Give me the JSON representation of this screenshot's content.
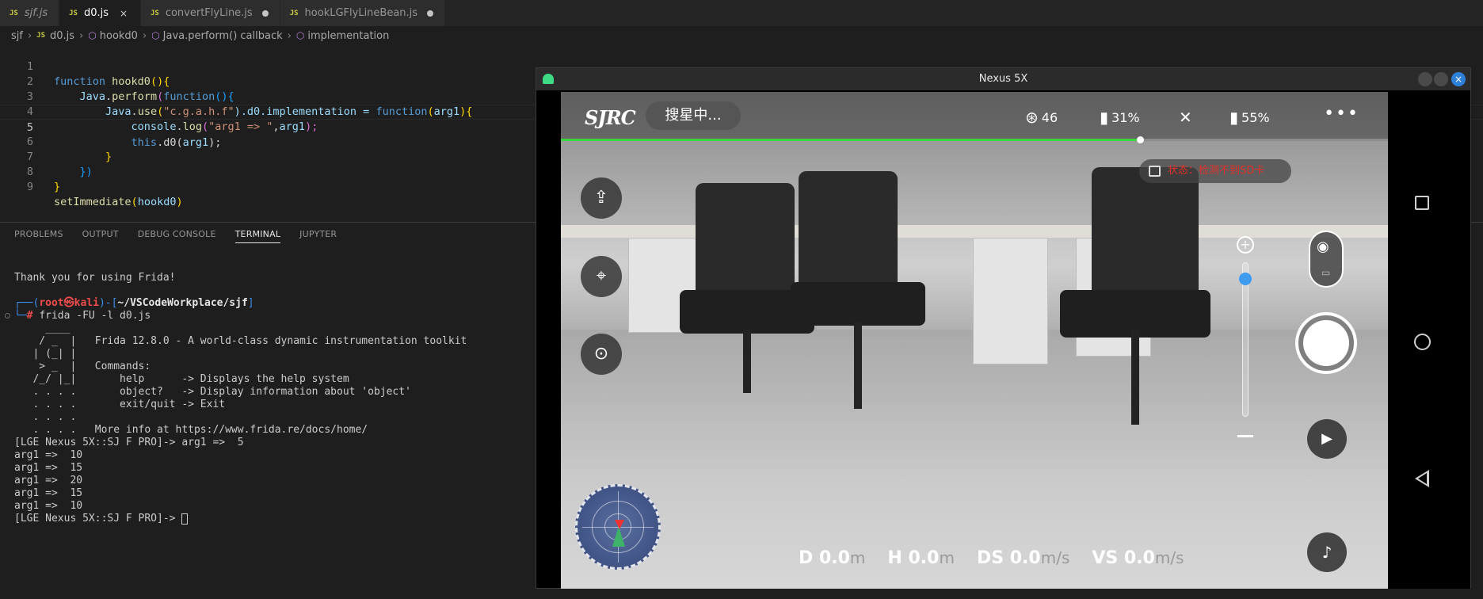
{
  "tabs": [
    {
      "icon": "JS",
      "label": "sjf.js",
      "state": "italic"
    },
    {
      "icon": "JS",
      "label": "d0.js",
      "state": "active",
      "control": "×"
    },
    {
      "icon": "JS",
      "label": "convertFlyLine.js",
      "state": "modified"
    },
    {
      "icon": "JS",
      "label": "hookLGFlyLineBean.js",
      "state": "modified"
    }
  ],
  "breadcrumb": {
    "folder": "sjf",
    "file_icon": "JS",
    "file": "d0.js",
    "symbol1": "hookd0",
    "symbol2": "Java.perform() callback",
    "symbol3": "implementation"
  },
  "editor": {
    "line_numbers": [
      "1",
      "2",
      "3",
      "4",
      "5",
      "6",
      "7",
      "8",
      "9"
    ],
    "current_line": "5",
    "code": {
      "l1_kw": "function",
      "l1_fn": "hookd0",
      "l1_rest": "(){",
      "l2_obj": "Java",
      "l2_fn": "perform",
      "l2_kw": "function",
      "l2_rest": "(){",
      "l3_obj": "Java",
      "l3_fn": "use",
      "l3_str": "\"c.g.a.h.f\"",
      "l3_prop": ").d0.implementation = ",
      "l3_kw": "function",
      "l3_arg": "arg1",
      "l3_rest": "){",
      "l4_obj": "console",
      "l4_fn": "log",
      "l4_str": "\"arg1 => \"",
      "l4_arg": "arg1",
      "l4_rest": ");",
      "l5_kw": "this",
      "l5_prop": ".d0(",
      "l5_arg": "arg1",
      "l5_rest": ");",
      "l6": "}",
      "l7": "})",
      "l8": "}",
      "l9_fn": "setImmediate",
      "l9_arg": "hookd0",
      "l9_rest": ")"
    }
  },
  "panel": {
    "tabs": [
      "PROBLEMS",
      "OUTPUT",
      "DEBUG CONSOLE",
      "TERMINAL",
      "JUPYTER"
    ],
    "active_tab": "TERMINAL"
  },
  "terminal": {
    "thanks": "Thank you for using Frida!",
    "prompt_user": "root㉿kali",
    "prompt_path": "~/VSCodeWorkplace/sjf",
    "command": "frida -FU -l d0.js",
    "banner": [
      "     ____",
      "    / _  |   Frida 12.8.0 - A world-class dynamic instrumentation toolkit",
      "   | (_| |",
      "    > _  |   Commands:",
      "   /_/ |_|       help      -> Displays the help system",
      "   . . . .       object?   -> Display information about 'object'",
      "   . . . .       exit/quit -> Exit",
      "   . . . .",
      "   . . . .   More info at https://www.frida.re/docs/home/"
    ],
    "output": [
      "[LGE Nexus 5X::SJ F PRO]-> arg1 =>  5",
      "arg1 =>  10",
      "arg1 =>  15",
      "arg1 =>  20",
      "arg1 =>  15",
      "arg1 =>  10"
    ],
    "final_prompt": "[LGE Nexus 5X::SJ F PRO]-> "
  },
  "emulator": {
    "title": "Nexus 5X",
    "close_glyph": "×",
    "app": {
      "logo": "SJRC",
      "search_status": "搜星中...",
      "satellites": "46",
      "battery_remote": "31%",
      "battery_phone": "55%",
      "more_glyph": "•••",
      "progress": 0.7,
      "sd_status": "状态：检测不到SD卡",
      "zoom_plus": "+",
      "telemetry": [
        {
          "label": "D",
          "value": "0.0",
          "unit": "m"
        },
        {
          "label": "H",
          "value": "0.0",
          "unit": "m"
        },
        {
          "label": "DS",
          "value": "0.0",
          "unit": "m/s"
        },
        {
          "label": "VS",
          "value": "0.0",
          "unit": "m/s"
        }
      ],
      "accent_green": "#3cd43c",
      "alert_red": "#e4312b",
      "zoom_blue": "#3d9bf0"
    }
  }
}
